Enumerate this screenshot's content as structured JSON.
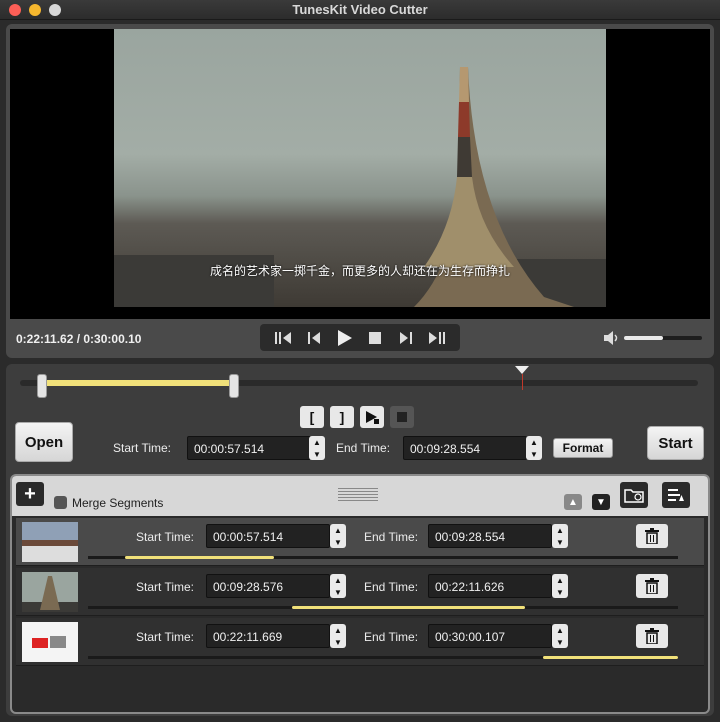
{
  "window": {
    "title": "TunesKit Video Cutter"
  },
  "player": {
    "subtitle": "成名的艺术家一掷千金，而更多的人却还在为生存而挣扎",
    "timecode": "0:22:11.62 / 0:30:00.10",
    "volume_level": 0.5
  },
  "editor": {
    "open_label": "Open",
    "start_label": "Start",
    "start_time_label": "Start Time:",
    "end_time_label": "End Time:",
    "start_time": "00:00:57.514",
    "end_time": "00:09:28.554",
    "format_label": "Format",
    "merge_label": "Merge Segments",
    "selection": {
      "start_fraction": 0.032,
      "end_fraction": 0.316
    },
    "playhead_fraction": 0.74
  },
  "segments": [
    {
      "start_label": "Start Time:",
      "end_label": "End Time:",
      "start": "00:00:57.514",
      "end": "00:09:28.554",
      "from_fraction": 0.032,
      "to_fraction": 0.316,
      "active": true
    },
    {
      "start_label": "Start Time:",
      "end_label": "End Time:",
      "start": "00:09:28.576",
      "end": "00:22:11.626",
      "from_fraction": 0.316,
      "to_fraction": 0.74,
      "active": false
    },
    {
      "start_label": "Start Time:",
      "end_label": "End Time:",
      "start": "00:22:11.669",
      "end": "00:30:00.107",
      "from_fraction": 0.74,
      "to_fraction": 1.0,
      "active": false
    }
  ],
  "colors": {
    "accent": "#f1e17a",
    "playhead": "#c0392b"
  }
}
